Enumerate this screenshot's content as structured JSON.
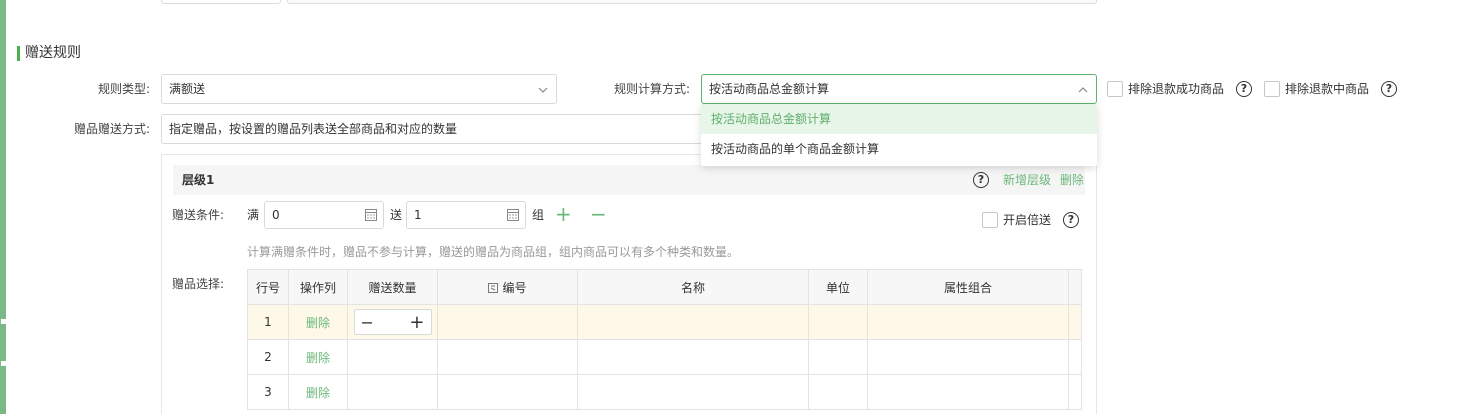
{
  "section": {
    "title": "赠送规则"
  },
  "rule_type": {
    "label": "规则类型:",
    "value": "满额送"
  },
  "calc_method": {
    "label": "规则计算方式:",
    "value": "按活动商品总金额计算",
    "options": [
      "按活动商品总金额计算",
      "按活动商品的单个商品金额计算"
    ]
  },
  "exclusions": {
    "refund_success": "排除退款成功商品",
    "refund_pending": "排除退款中商品",
    "help": "?"
  },
  "gift_method": {
    "label": "赠品赠送方式:",
    "value": "指定赠品，按设置的赠品列表送全部商品和对应的数量"
  },
  "level": {
    "title": "层级1",
    "add_level": "新增层级",
    "delete": "删除",
    "condition_label": "赠送条件:",
    "prefix": "满",
    "threshold": "0",
    "middle": "送",
    "amount": "1",
    "unit": "组",
    "plus": "+",
    "minus": "−",
    "double_label": "开启倍送",
    "hint": "计算满赠条件时，赠品不参与计算，赠送的赠品为商品组，组内商品可以有多个种类和数量。",
    "gift_select_label": "赠品选择:"
  },
  "table": {
    "headers": [
      "行号",
      "操作列",
      "赠送数量",
      "编号",
      "名称",
      "单位",
      "属性组合"
    ],
    "rows": [
      {
        "num": "1",
        "action": "删除"
      },
      {
        "num": "2",
        "action": "删除"
      },
      {
        "num": "3",
        "action": "删除"
      }
    ]
  },
  "colors": {
    "accent": "#6bb87a",
    "sidebar": "#7ab888",
    "highlight_row": "#fdf8e8"
  }
}
